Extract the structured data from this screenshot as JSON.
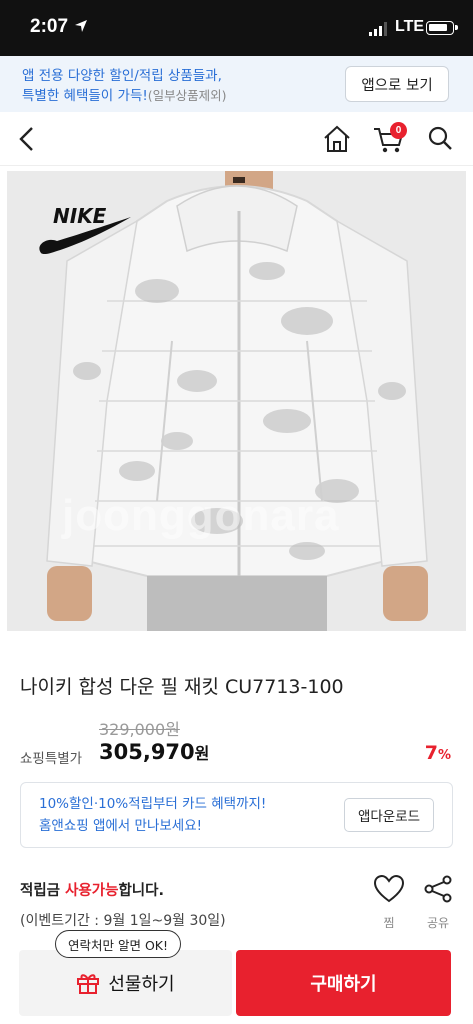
{
  "status_bar": {
    "time": "2:07",
    "carrier": "LTE"
  },
  "banner": {
    "line1": "앱 전용 다양한 할인/적립 상품들과,",
    "line2": "특별한 혜택들이 가득!",
    "note": "(일부상품제외)",
    "button": "앱으로 보기"
  },
  "nav": {
    "cart_count": "0"
  },
  "product": {
    "brand_logo": "NIKE",
    "watermark": "joonggonara",
    "title": "나이키 합성 다운 필 재킷 CU7713-100",
    "original_price": "329,000원",
    "price_label": "쇼핑특별가",
    "sale_price_number": "305,970",
    "sale_price_unit": "원",
    "discount_number": "7",
    "discount_unit": "%"
  },
  "promo": {
    "line1": "10%할인·10%적립부터 카드 혜택까지!",
    "line2": "홈앤쇼핑 앱에서 만나보세요!",
    "button": "앱다운로드"
  },
  "points": {
    "prefix": "적립금 ",
    "highlight": "사용가능",
    "suffix": "합니다.",
    "period": "(이벤트기간 : 9월 1일~9월 30일)",
    "like_label": "찜",
    "share_label": "공유"
  },
  "bottom_bar": {
    "tooltip": "연락처만 알면 OK!",
    "gift_label": "선물하기",
    "buy_label": "구매하기"
  },
  "colors": {
    "accent_red": "#e8212e",
    "link_blue": "#2a6fd6",
    "banner_bg": "#eef4fb"
  },
  "icons": [
    "location-arrow-icon",
    "signal-icon",
    "battery-icon",
    "back-icon",
    "home-icon",
    "cart-icon",
    "search-icon",
    "heart-icon",
    "share-icon",
    "gift-icon"
  ]
}
